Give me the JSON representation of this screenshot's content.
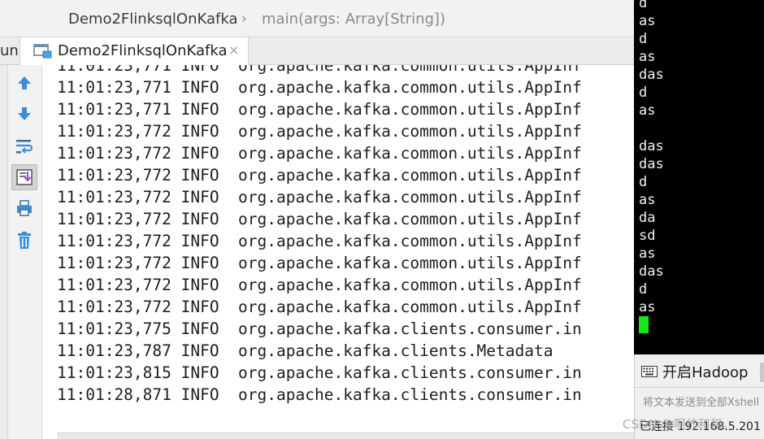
{
  "breadcrumb": {
    "file": "Demo2FlinksqlOnKafka",
    "separator": "›",
    "method": "main(args: Array[String])"
  },
  "run_panel": {
    "label": "un:",
    "tab_title": "Demo2FlinksqlOnKafka",
    "tab_close": "×"
  },
  "toolbar_icons": [
    "arrow-up-icon",
    "arrow-down-icon",
    "soft-wrap-icon",
    "scroll-to-end-icon",
    "print-icon",
    "trash-icon"
  ],
  "console": {
    "lines": [
      "11:01:23,771 INFO  org.apache.kafka.common.utils.AppInf",
      "11:01:23,771 INFO  org.apache.kafka.common.utils.AppInf",
      "11:01:23,771 INFO  org.apache.kafka.common.utils.AppInf",
      "11:01:23,772 INFO  org.apache.kafka.common.utils.AppInf",
      "11:01:23,772 INFO  org.apache.kafka.common.utils.AppInf",
      "11:01:23,772 INFO  org.apache.kafka.common.utils.AppInf",
      "11:01:23,772 INFO  org.apache.kafka.common.utils.AppInf",
      "11:01:23,772 INFO  org.apache.kafka.common.utils.AppInf",
      "11:01:23,772 INFO  org.apache.kafka.common.utils.AppInf",
      "11:01:23,772 INFO  org.apache.kafka.common.utils.AppInf",
      "11:01:23,772 INFO  org.apache.kafka.common.utils.AppInf",
      "11:01:23,772 INFO  org.apache.kafka.common.utils.AppInf",
      "11:01:23,775 INFO  org.apache.kafka.clients.consumer.in",
      "11:01:23,787 INFO  org.apache.kafka.clients.Metadata",
      "11:01:23,815 INFO  org.apache.kafka.clients.consumer.in",
      "11:01:28,871 INFO  org.apache.kafka.clients.consumer.in"
    ]
  },
  "terminal": {
    "lines": [
      "d",
      "as",
      "d",
      "as",
      "das",
      "d",
      "as",
      "",
      "das",
      "das",
      "d",
      "as",
      "da",
      "sd",
      "as",
      "das",
      "d",
      "as"
    ]
  },
  "xshell": {
    "session_button": "开启Hadoop",
    "send_placeholder": "将文本发送到全部Xshell",
    "status": "已连接 192.168.5.201",
    "watermark": "CSDN @啊帅和和。"
  },
  "colors": {
    "terminal_bg": "#000000",
    "terminal_fg": "#f2f2f2",
    "cursor": "#19e619",
    "ide_icon_blue": "#3b8ed6"
  }
}
